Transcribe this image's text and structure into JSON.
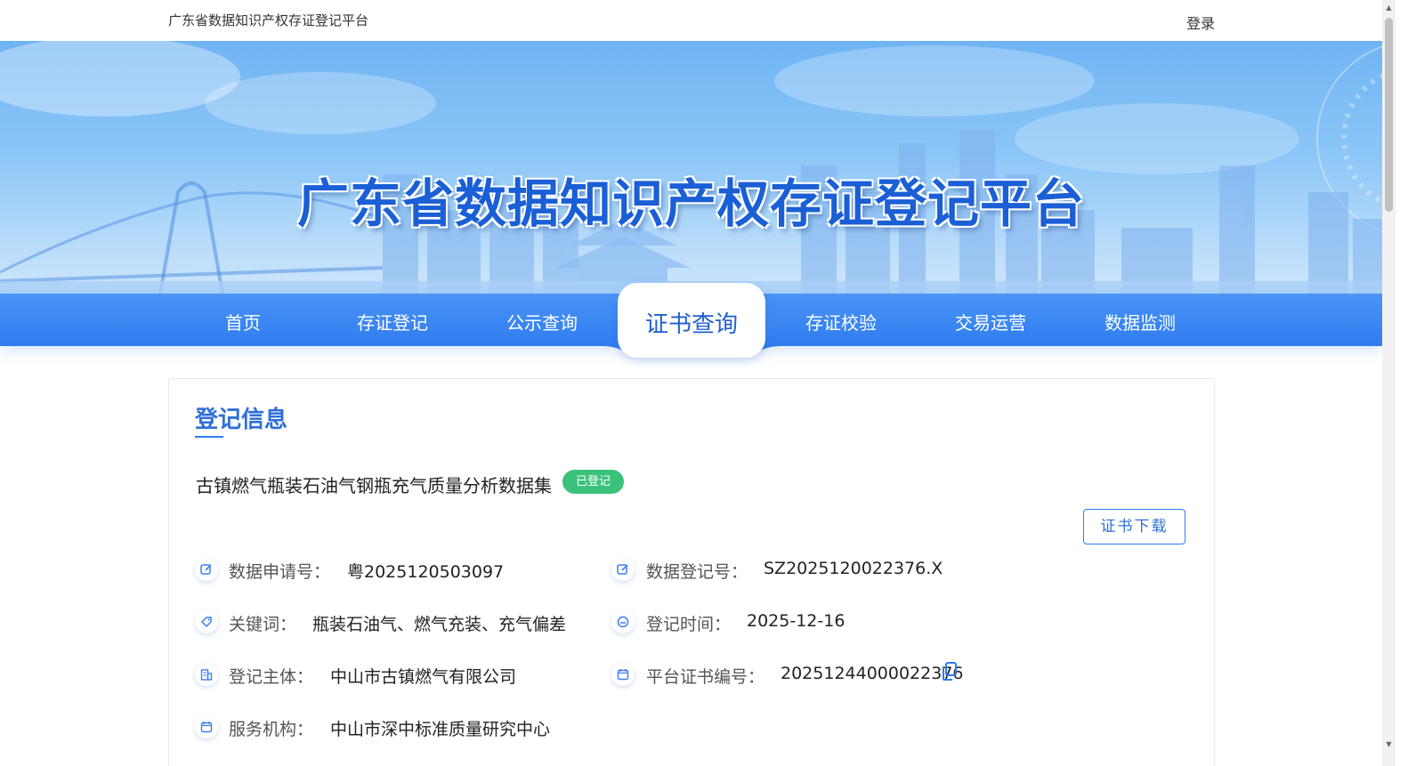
{
  "topbar": {
    "site_name": "广东省数据知识产权存证登记平台",
    "login_label": "登录"
  },
  "banner": {
    "title": "广东省数据知识产权存证登记平台"
  },
  "nav": {
    "items": [
      "首页",
      "存证登记",
      "公示查询",
      "证书查询",
      "存证校验",
      "交易运营",
      "数据监测"
    ],
    "active_index": 3
  },
  "card": {
    "section_title": "登记信息",
    "dataset_name": "古镇燃气瓶装石油气钢瓶充气质量分析数据集",
    "status": "已登记",
    "download_label": "证书下载",
    "fields": {
      "application_no": {
        "label": "数据申请号：",
        "value": "粤2025120503097"
      },
      "registration_no": {
        "label": "数据登记号：",
        "value": "SZ2025120022376.X"
      },
      "keywords": {
        "label": "关键词：",
        "value": "瓶装石油气、燃气充装、充气偏差"
      },
      "registration_time": {
        "label": "登记时间：",
        "value": "2025-12-16"
      },
      "registrant": {
        "label": "登记主体：",
        "value": "中山市古镇燃气有限公司"
      },
      "certificate_no": {
        "label": "平台证书编号：",
        "value": "20251244000022376"
      },
      "service_org": {
        "label": "服务机构：",
        "value": "中山市深中标准质量研究中心"
      }
    }
  },
  "colors": {
    "primary": "#2f7cf0",
    "title_blue": "#2f6fd8",
    "status_green": "#3bc27a"
  },
  "icons": [
    "edit-icon",
    "tag-icon",
    "building-icon",
    "calendar-icon",
    "clock-icon",
    "copy-icon"
  ]
}
